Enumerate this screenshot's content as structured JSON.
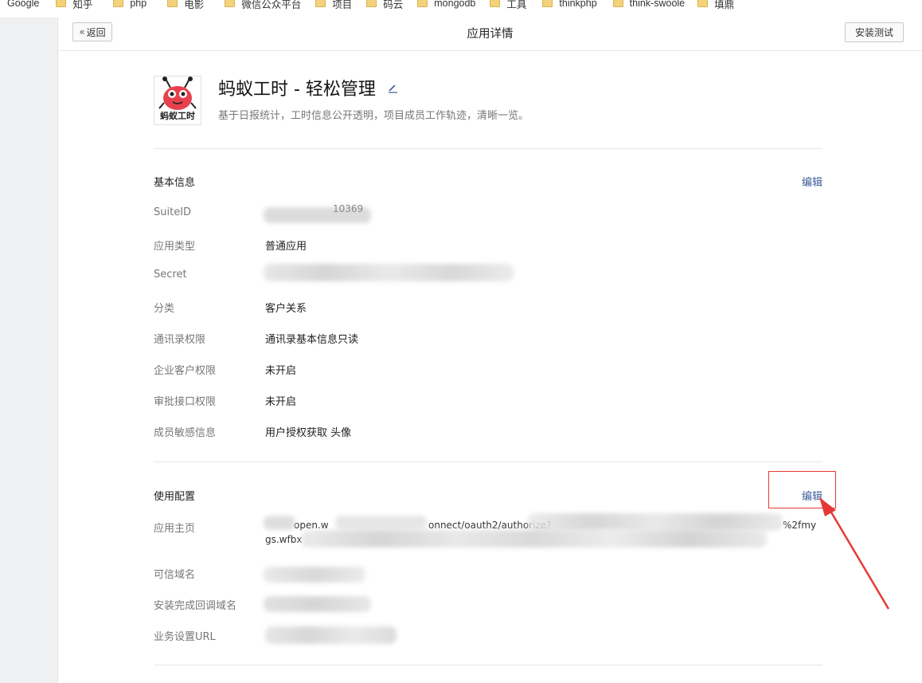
{
  "bookmarks": [
    "Google",
    "知乎",
    "php",
    "电影",
    "微信公众平台",
    "项目",
    "码云",
    "mongodb",
    "工具",
    "thinkphp",
    "think-swoole",
    "填鼎"
  ],
  "topbar": {
    "back_label": "返回",
    "title": "应用详情",
    "install_label": "安装测试"
  },
  "app": {
    "logo_text": "蚂蚁工时",
    "name": "蚂蚁工时 - 轻松管理",
    "description": "基于日报统计，工时信息公开透明，项目成员工作轨迹，清晰一览。"
  },
  "basic": {
    "title": "基本信息",
    "edit_label": "编辑",
    "rows": [
      {
        "label": "SuiteID",
        "value": "10369"
      },
      {
        "label": "应用类型",
        "value": "普通应用"
      },
      {
        "label": "Secret",
        "value": ""
      },
      {
        "label": "分类",
        "value": "客户关系"
      },
      {
        "label": "通讯录权限",
        "value": "通讯录基本信息只读"
      },
      {
        "label": "企业客户权限",
        "value": "未开启"
      },
      {
        "label": "审批接口权限",
        "value": "未开启"
      },
      {
        "label": "成员敏感信息",
        "value": "用户授权获取 头像"
      }
    ]
  },
  "config": {
    "title": "使用配置",
    "edit_label": "编辑",
    "rows": [
      {
        "label": "应用主页",
        "value_line1": "open.w",
        "value_line1b": "onnect/oauth2/authorize?",
        "value_line1c": "%2fmy",
        "value_line2": "gs.wfbx"
      },
      {
        "label": "可信域名",
        "value": ""
      },
      {
        "label": "安装完成回调域名",
        "value": ""
      },
      {
        "label": "业务设置URL",
        "value": ""
      }
    ]
  },
  "colors": {
    "link": "#3b5d9a",
    "highlight": "#e53935",
    "logo_red": "#e8414e"
  }
}
